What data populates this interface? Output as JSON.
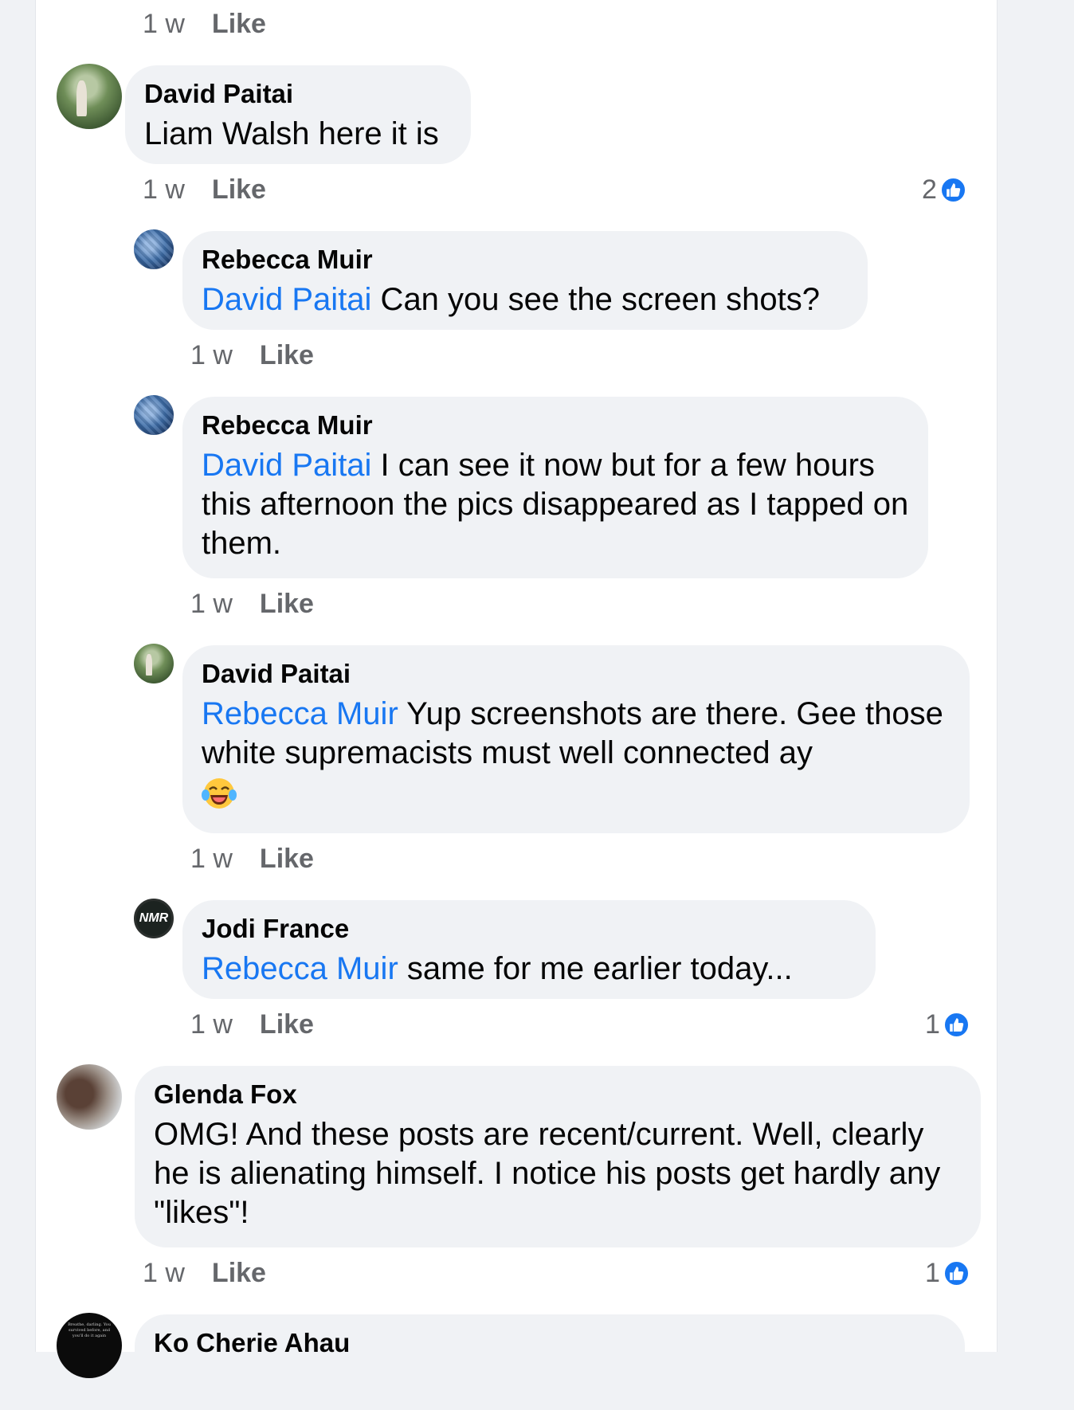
{
  "top_meta": {
    "time": "1 w",
    "like": "Like"
  },
  "comments": [
    {
      "author": "David Paitai",
      "text": "Liam Walsh here it is",
      "time": "1 w",
      "like": "Like",
      "reaction_count": "2"
    },
    {
      "author": "Rebecca Muir",
      "mention": "David Paitai",
      "text": " Can you see the screen shots?",
      "time": "1 w",
      "like": "Like"
    },
    {
      "author": "Rebecca Muir",
      "mention": "David Paitai",
      "text": " I can see it now but for a few hours this afternoon the pics disappeared as I tapped on them.",
      "time": "1 w",
      "like": "Like"
    },
    {
      "author": "David Paitai",
      "mention": "Rebecca Muir",
      "text": " Yup screenshots are there. Gee those white supremacists must well connected ay",
      "emoji": "laughing-tears-emoji",
      "time": "1 w",
      "like": "Like"
    },
    {
      "author": "Jodi France",
      "mention": "Rebecca Muir",
      "text": " same for me earlier today...",
      "time": "1 w",
      "like": "Like",
      "reaction_count": "1",
      "avatar_text": "NMR"
    },
    {
      "author": "Glenda Fox",
      "text": "OMG! And these posts are recent/current. Well, clearly he is alienating himself. I notice his posts get hardly any \"likes\"!",
      "time": "1 w",
      "like": "Like",
      "reaction_count": "1"
    },
    {
      "author": "Ko Cherie Ahau",
      "avatar_text": "Breathe, darling. You survived before, and you'll do it again"
    }
  ],
  "colors": {
    "mention": "#1877f2",
    "bubble": "#f0f2f5",
    "meta": "#65676b",
    "like_badge": "#1877f2"
  },
  "icons": {
    "reaction": "thumbs-up-icon"
  }
}
